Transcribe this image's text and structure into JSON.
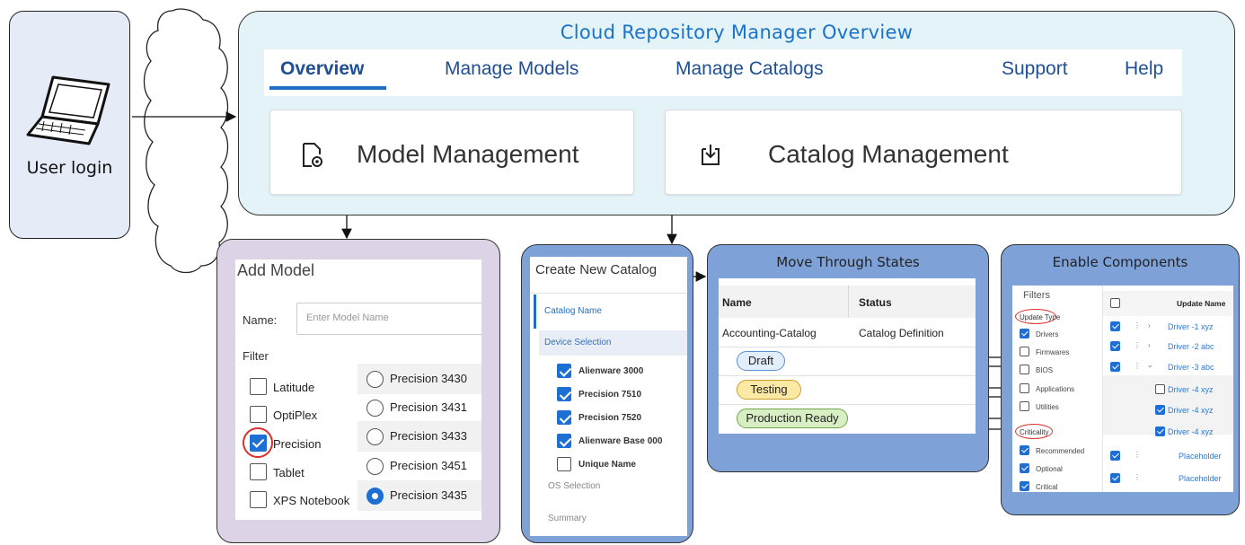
{
  "user": {
    "label": "User login"
  },
  "overview": {
    "title": "Cloud Repository Manager Overview",
    "nav": {
      "overview": "Overview",
      "models": "Manage Models",
      "catalogs": "Manage Catalogs",
      "support": "Support",
      "help": "Help"
    },
    "cards": {
      "model": "Model Management",
      "catalog": "Catalog Management"
    }
  },
  "add_model": {
    "title": "Add Model",
    "name_label": "Name:",
    "name_placeholder": "Enter Model Name",
    "filter_label": "Filter",
    "filters": [
      {
        "label": "Latitude",
        "checked": false
      },
      {
        "label": "OptiPlex",
        "checked": false
      },
      {
        "label": "Precision",
        "checked": true
      },
      {
        "label": "Tablet",
        "checked": false
      },
      {
        "label": "XPS Notebook",
        "checked": false
      }
    ],
    "models": [
      {
        "label": "Precision 3430",
        "selected": false
      },
      {
        "label": "Precision 3431",
        "selected": false
      },
      {
        "label": "Precision 3433",
        "selected": false
      },
      {
        "label": "Precision 3451",
        "selected": false
      },
      {
        "label": "Precision 3435",
        "selected": true
      }
    ]
  },
  "new_catalog": {
    "title": "Create New Catalog",
    "steps": {
      "name": "Catalog Name",
      "device": "Device Selection",
      "os": "OS Selection",
      "summary": "Summary"
    },
    "devices": [
      {
        "label": "Alienware 3000",
        "checked": true
      },
      {
        "label": "Precision 7510",
        "checked": true
      },
      {
        "label": "Precision 7520",
        "checked": true
      },
      {
        "label": "Alienware Base 000",
        "checked": true
      },
      {
        "label": "Unique Name",
        "checked": false
      }
    ]
  },
  "states": {
    "title": "Move Through States",
    "col_name": "Name",
    "col_status": "Status",
    "row_name": "Accounting-Catalog",
    "row_status": "Catalog Definition",
    "pills": [
      "Draft",
      "Testing",
      "Production Ready"
    ],
    "colors": {
      "draft": "#e3eefb",
      "testing": "#fde9a6",
      "production": "#d8efc4"
    }
  },
  "components": {
    "title": "Enable Components",
    "filters_label": "Filters",
    "update_type_label": "Update Type",
    "update_types": [
      {
        "label": "Drivers",
        "checked": true
      },
      {
        "label": "Firmwares",
        "checked": false
      },
      {
        "label": "BIOS",
        "checked": false
      },
      {
        "label": "Applications",
        "checked": false
      },
      {
        "label": "Utilities",
        "checked": false
      }
    ],
    "criticality_label": "Criticality",
    "criticality": [
      {
        "label": "Recommended",
        "checked": true
      },
      {
        "label": "Optional",
        "checked": true
      },
      {
        "label": "Critical",
        "checked": true
      }
    ],
    "col_update_name": "Update Name",
    "updates": [
      "Driver -1 xyz",
      "Driver -2 abc",
      "Driver -3 abc",
      "Driver -4 xyz",
      "Driver -4 xyz",
      "Driver -4 xyz",
      "Placeholder",
      "Placeholder"
    ]
  },
  "colors": {
    "accent": "#1f6fc5",
    "highlight": "#d9302c",
    "panel_blue": "#7ea2d8",
    "panel_purple": "#ddd3e7",
    "panel_cyan": "#e3f3f8"
  }
}
